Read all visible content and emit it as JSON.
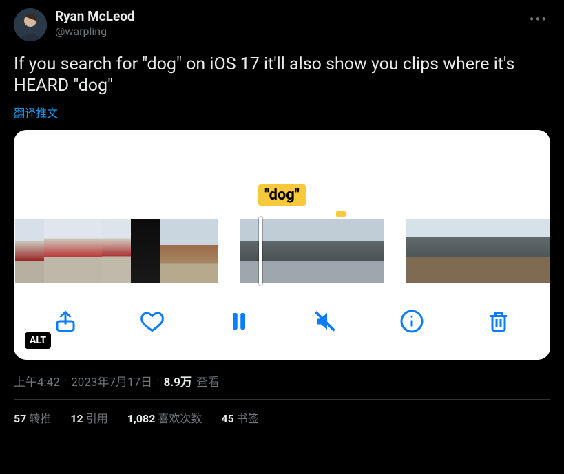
{
  "author": {
    "display_name": "Ryan McLeod",
    "handle": "@warpling"
  },
  "tweet_text": "If you search for \"dog\" on iOS 17 it'll also show you clips where it's HEARD \"dog\"",
  "translate_label": "翻译推文",
  "media": {
    "caption": "\"dog\"",
    "alt_badge": "ALT",
    "toolbar": {
      "share": "share-icon",
      "heart": "heart-icon",
      "pause": "pause-icon",
      "mute": "mute-icon",
      "info": "info-icon",
      "trash": "trash-icon"
    }
  },
  "meta": {
    "time": "上午4:42",
    "date": "2023年7月17日",
    "views_count": "8.9万",
    "views_label": "查看"
  },
  "stats": {
    "retweets": {
      "count": "57",
      "label": "转推"
    },
    "quotes": {
      "count": "12",
      "label": "引用"
    },
    "likes": {
      "count": "1,082",
      "label": "喜欢次数"
    },
    "bookmarks": {
      "count": "45",
      "label": "书签"
    }
  }
}
